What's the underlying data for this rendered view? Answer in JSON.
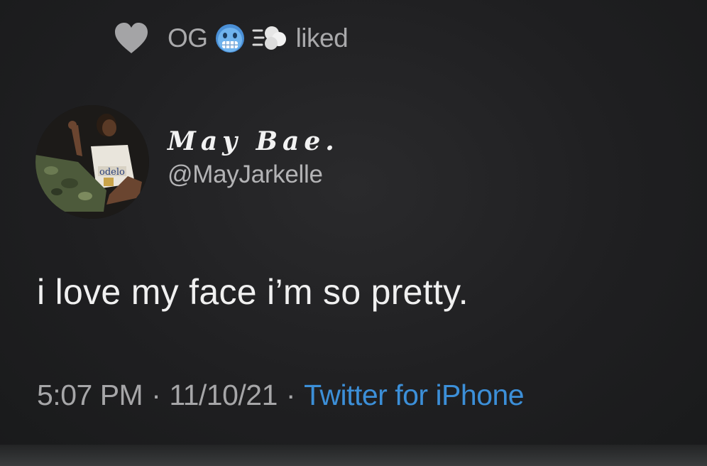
{
  "social_context": {
    "liker_name": "OG",
    "liker_emojis": [
      "cold-face-emoji",
      "dash-emoji"
    ],
    "action_label": "liked"
  },
  "author": {
    "display_name": "May Bae.",
    "handle": "@MayJarkelle",
    "avatar_shirt_text": "odelo"
  },
  "tweet": {
    "text": "i love my face i’m so pretty."
  },
  "meta": {
    "time": "5:07 PM",
    "separator": "·",
    "date": "11/10/21",
    "source": "Twitter for iPhone"
  },
  "colors": {
    "background": "#1f1f21",
    "primary_text": "#f0f0f0",
    "secondary_text": "#a6a6a8",
    "link": "#3c8fd8"
  }
}
